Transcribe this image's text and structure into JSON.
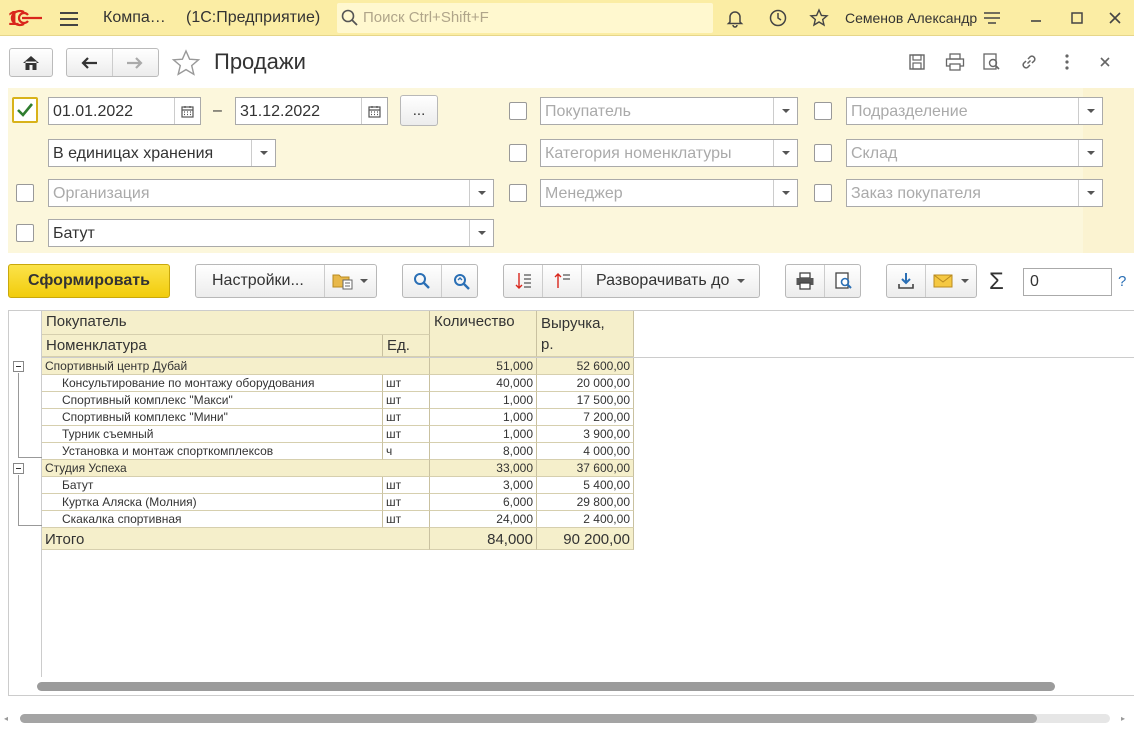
{
  "app": {
    "title": "Компа…",
    "platform": "(1С:Предприятие)",
    "search_placeholder": "Поиск Ctrl+Shift+F",
    "user": "Семенов Александр"
  },
  "form": {
    "title": "Продажи"
  },
  "filters": {
    "period_enabled": true,
    "date_from": "01.01.2022",
    "date_to": "31.12.2022",
    "dash": "–",
    "period_button": "...",
    "units": "В единицах хранения",
    "organization_placeholder": "Организация",
    "nomenclature_value": "Батут",
    "buyer_placeholder": "Покупатель",
    "category_placeholder": "Категория номенклатуры",
    "manager_placeholder": "Менеджер",
    "division_placeholder": "Подразделение",
    "warehouse_placeholder": "Склад",
    "order_placeholder": "Заказ покупателя"
  },
  "toolbar": {
    "generate_label": "Сформировать",
    "settings_label": "Настройки...",
    "expand_label": "Разворачивать до",
    "sum_value": "0",
    "help": "?",
    "sigma": "Σ"
  },
  "report": {
    "headers": {
      "buyer": "Покупатель",
      "nomenclature": "Номенклатура",
      "unit": "Ед.",
      "quantity": "Количество",
      "revenue": "Выручка,\nр."
    },
    "groups": [
      {
        "name": "Спортивный центр Дубай",
        "quantity": "51,000",
        "revenue": "52 600,00",
        "rows": [
          {
            "name": "Консультирование по монтажу оборудования",
            "unit": "шт",
            "quantity": "40,000",
            "revenue": "20 000,00"
          },
          {
            "name": "Спортивный комплекс \"Макси\"",
            "unit": "шт",
            "quantity": "1,000",
            "revenue": "17 500,00"
          },
          {
            "name": "Спортивный комплекс \"Мини\"",
            "unit": "шт",
            "quantity": "1,000",
            "revenue": "7 200,00"
          },
          {
            "name": "Турник съемный",
            "unit": "шт",
            "quantity": "1,000",
            "revenue": "3 900,00"
          },
          {
            "name": "Установка и монтаж спорткомплексов",
            "unit": "ч",
            "quantity": "8,000",
            "revenue": "4 000,00"
          }
        ]
      },
      {
        "name": "Студия Успеха",
        "quantity": "33,000",
        "revenue": "37 600,00",
        "rows": [
          {
            "name": "Батут",
            "unit": "шт",
            "quantity": "3,000",
            "revenue": "5 400,00"
          },
          {
            "name": "Куртка Аляска (Молния)",
            "unit": "шт",
            "quantity": "6,000",
            "revenue": "29 800,00"
          },
          {
            "name": "Скакалка спортивная",
            "unit": "шт",
            "quantity": "24,000",
            "revenue": "2 400,00"
          }
        ]
      }
    ],
    "total": {
      "label": "Итого",
      "quantity": "84,000",
      "revenue": "90 200,00"
    }
  }
}
